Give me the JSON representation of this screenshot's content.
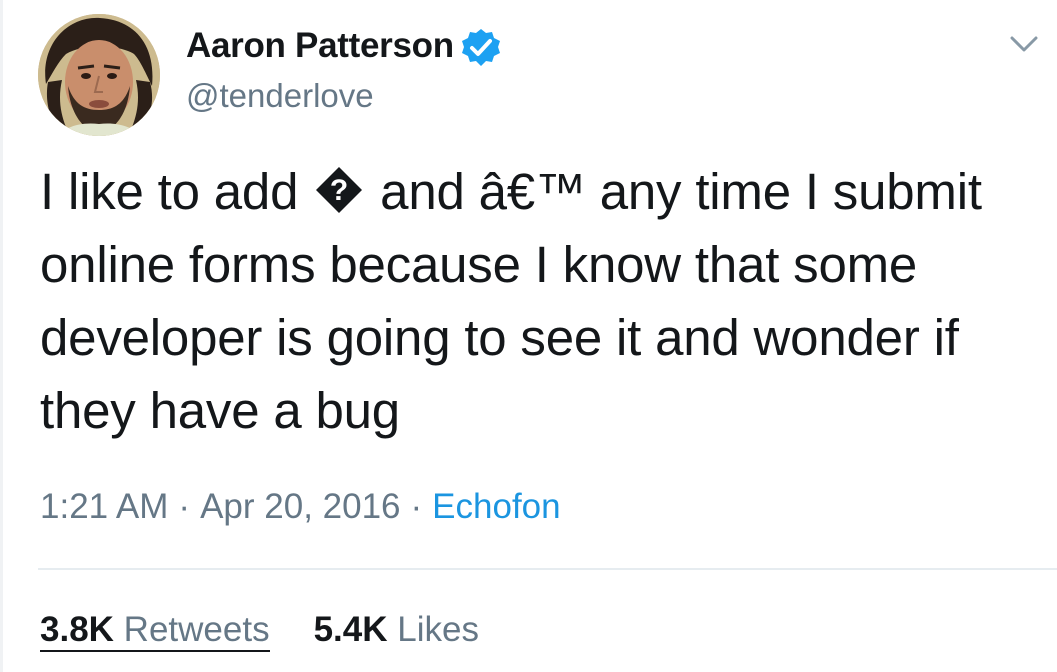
{
  "tweet": {
    "author": {
      "display_name": "Aaron Patterson",
      "handle": "@tenderlove",
      "verified": true
    },
    "text_parts": {
      "before": "I like to add ",
      "after_glyph": " and â€™ any time I submit online forms because I know that some developer is going to see it and wonder if they have a bug",
      "glyph_char": "?"
    },
    "meta": {
      "time": "1:21 AM",
      "separator": "·",
      "date": "Apr 20, 2016",
      "source": "Echofon"
    },
    "stats": {
      "retweets_count": "3.8K",
      "retweets_label": "Retweets",
      "likes_count": "5.4K",
      "likes_label": "Likes"
    }
  },
  "icons": {
    "verified": "verified-badge-icon",
    "caret": "chevron-down-icon",
    "glyph": "replacement-character-icon"
  },
  "colors": {
    "text": "#14171a",
    "secondary": "#657786",
    "link": "#1b95e0",
    "verified_badge": "#1da1f2",
    "divider": "#e6ecf0"
  }
}
